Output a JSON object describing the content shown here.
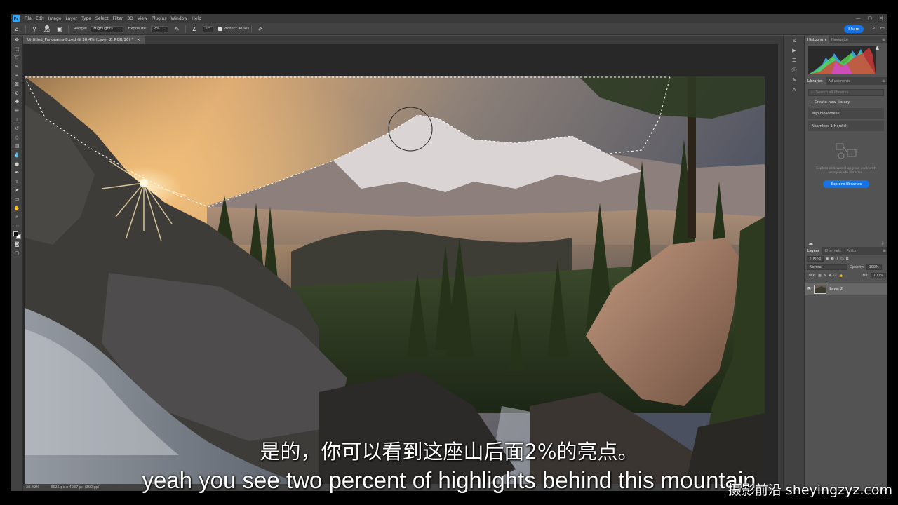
{
  "menubar": {
    "app_icon": "Ps",
    "items": [
      "File",
      "Edit",
      "Image",
      "Layer",
      "Type",
      "Select",
      "Filter",
      "3D",
      "View",
      "Plugins",
      "Window",
      "Help"
    ],
    "window_controls": [
      "—",
      "▢",
      "✕"
    ]
  },
  "options_bar": {
    "brush_size": "250",
    "range_label": "Range:",
    "range_value": "Highlights",
    "exposure_label": "Exposure:",
    "exposure_value": "2%",
    "angle_value": "0°",
    "protect_tones_label": "Protect Tones",
    "share_label": "Share"
  },
  "document": {
    "tab_title": "Untitled_Panorama-8.psd @ 38.4% (Layer 2, RGB/16) *",
    "close_glyph": "×"
  },
  "status_bar": {
    "zoom": "38.42%",
    "doc_info": "8625 px x 4237 px (300 ppi)"
  },
  "panels": {
    "histogram_tabs": [
      "Histogram",
      "Navigator"
    ],
    "library_tabs": [
      "Libraries",
      "Adjustments"
    ],
    "library_search_placeholder": "Search all libraries",
    "create_library": "Create new library",
    "libraries": [
      "Mijn bibliotheek",
      "Naamloos-1-Herstelt"
    ],
    "library_empty_text": "Explore and speed up your work with ready-made libraries.",
    "explore_button": "Explore libraries",
    "layers_tabs": [
      "Layers",
      "Channels",
      "Paths"
    ],
    "kind_label": "Kind",
    "blend_mode": "Normal",
    "opacity_label": "Opacity:",
    "opacity_value": "100%",
    "lock_label": "Lock:",
    "fill_label": "Fill:",
    "fill_value": "100%",
    "layer_name": "Layer 2"
  },
  "colors": {
    "accent": "#1473e6",
    "ps_blue": "#31a8ff",
    "chrome_dark": "#424242",
    "chrome_mid": "#535353"
  },
  "subtitles": {
    "chinese": "是的，你可以看到这座山后面2%的亮点。",
    "english": "yeah you see two percent of highlights behind this mountain"
  },
  "watermark": "摄影前沿 sheyingzyz.com"
}
